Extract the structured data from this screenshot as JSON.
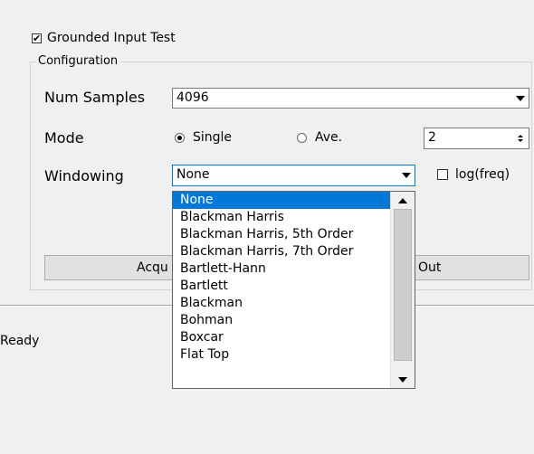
{
  "grounded_input_test": {
    "label": "Grounded Input Test",
    "checked": true
  },
  "configuration": {
    "title": "Configuration",
    "num_samples": {
      "label": "Num Samples",
      "value": "4096"
    },
    "mode": {
      "label": "Mode",
      "options": [
        {
          "label": "Single",
          "selected": true
        },
        {
          "label": "Ave.",
          "selected": false
        }
      ],
      "ave_count": "2"
    },
    "windowing": {
      "label": "Windowing",
      "value": "None",
      "log_freq": {
        "label": "log(freq)",
        "checked": false
      },
      "options": [
        "None",
        "Blackman Harris",
        "Blackman Harris, 5th Order",
        "Blackman Harris, 7th Order",
        "Bartlett-Hann",
        "Bartlett",
        "Blackman",
        "Bohman",
        "Boxcar",
        "Flat Top"
      ]
    },
    "buttons": {
      "acquire_partial": "Acqu",
      "out_partial": "Out"
    }
  },
  "status": {
    "text": "Ready"
  },
  "colors": {
    "selection": "#0078d7",
    "background": "#f0f0f0"
  }
}
